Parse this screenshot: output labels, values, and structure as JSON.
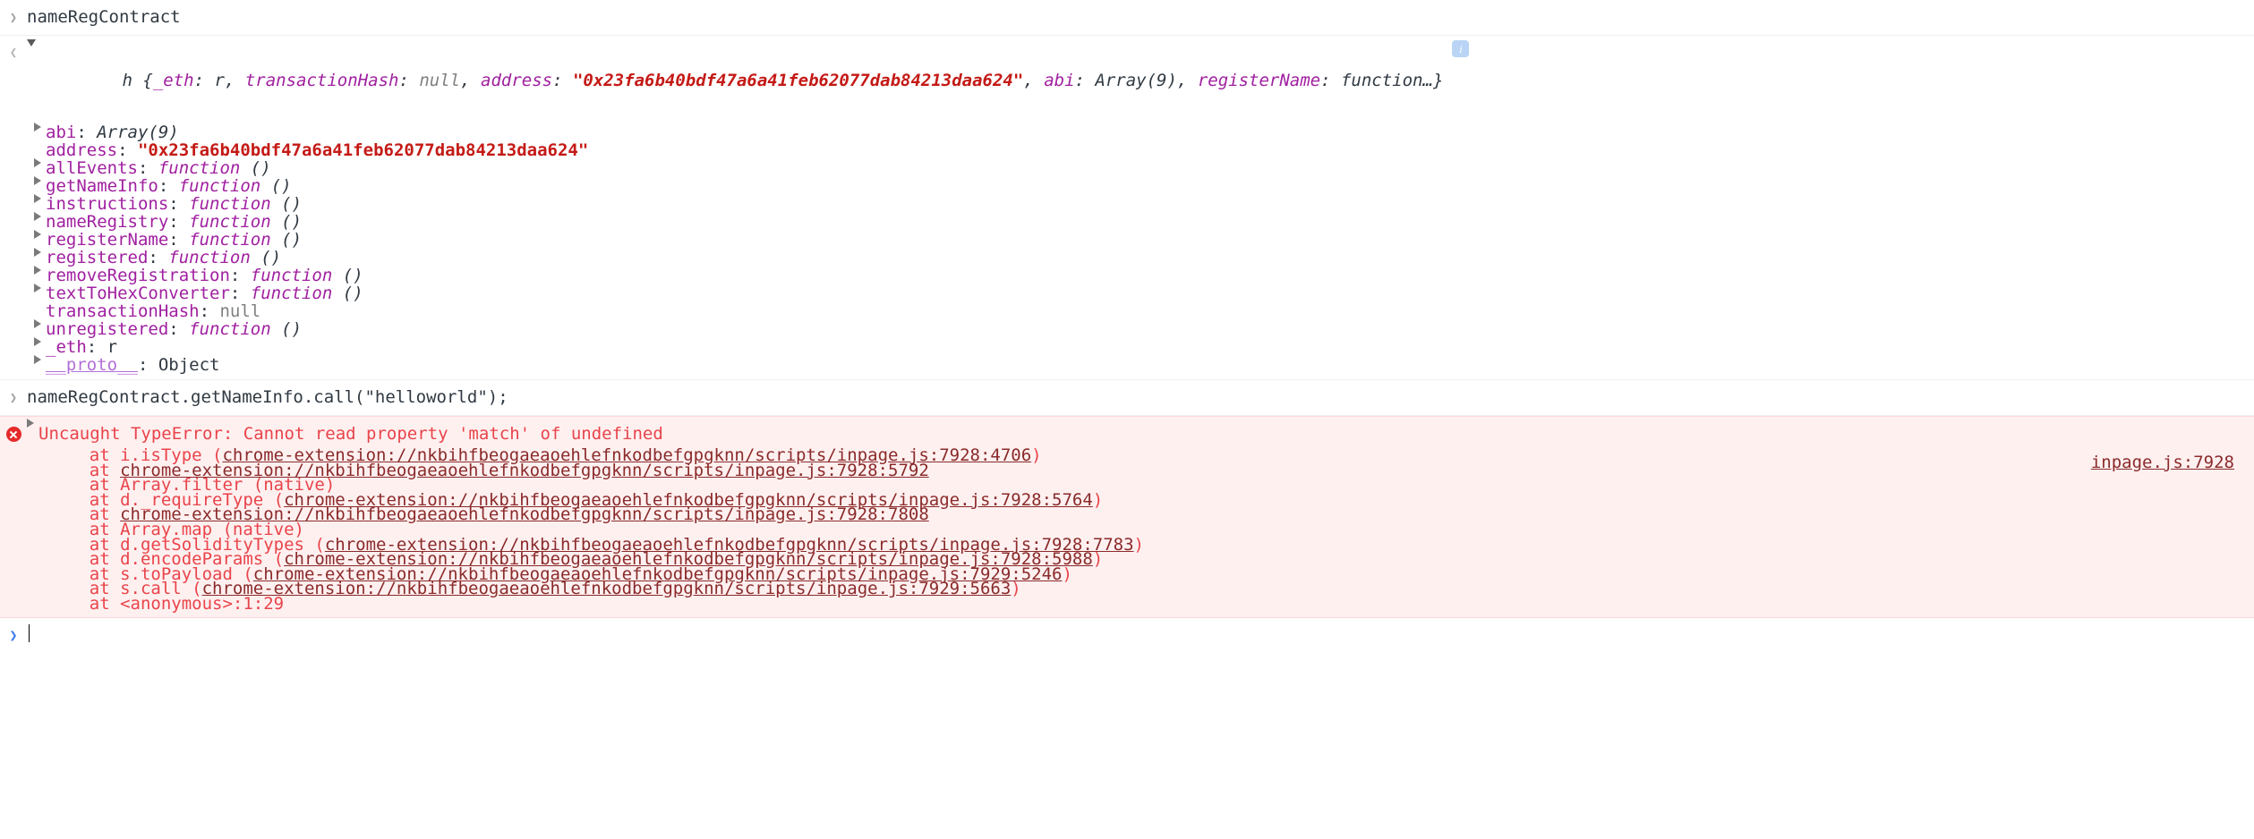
{
  "console": {
    "input_prompt_glyph": "chevron-right",
    "result_prompt_glyph": "chevron-left",
    "commands": [
      {
        "text": "nameRegContract"
      },
      {
        "text": "nameRegContract.getNameInfo.call(\"helloworld\");"
      }
    ],
    "result": {
      "constructor": "h",
      "preview": {
        "open_brace": " {",
        "close": "}",
        "entries": [
          {
            "key": "_eth",
            "sep": ": ",
            "value": "r",
            "value_kind": "class",
            "trail": ", "
          },
          {
            "key": "transactionHash",
            "sep": ": ",
            "value": "null",
            "value_kind": "null",
            "trail": ", "
          },
          {
            "key": "address",
            "sep": ": ",
            "value": "\"0x23fa6b40bdf47a6a41feb62077dab84213daa624\"",
            "value_kind": "string",
            "trail": ", "
          },
          {
            "key": "abi",
            "sep": ": ",
            "value": "Array(9)",
            "value_kind": "class",
            "trail": ", "
          },
          {
            "key": "registerName",
            "sep": ": ",
            "value": "function…",
            "value_kind": "class",
            "trail": ""
          }
        ]
      },
      "info_badge": "i",
      "properties": [
        {
          "expandable": true,
          "name": "abi",
          "sep": ": ",
          "value": "Array(9)",
          "kind": "class"
        },
        {
          "expandable": false,
          "name": "address",
          "sep": ": ",
          "value": "\"0x23fa6b40bdf47a6a41feb62077dab84213daa624\"",
          "kind": "string"
        },
        {
          "expandable": true,
          "name": "allEvents",
          "sep": ": ",
          "value": "function ()",
          "kind": "function"
        },
        {
          "expandable": true,
          "name": "getNameInfo",
          "sep": ": ",
          "value": "function ()",
          "kind": "function"
        },
        {
          "expandable": true,
          "name": "instructions",
          "sep": ": ",
          "value": "function ()",
          "kind": "function"
        },
        {
          "expandable": true,
          "name": "nameRegistry",
          "sep": ": ",
          "value": "function ()",
          "kind": "function"
        },
        {
          "expandable": true,
          "name": "registerName",
          "sep": ": ",
          "value": "function ()",
          "kind": "function"
        },
        {
          "expandable": true,
          "name": "registered",
          "sep": ": ",
          "value": "function ()",
          "kind": "function"
        },
        {
          "expandable": true,
          "name": "removeRegistration",
          "sep": ": ",
          "value": "function ()",
          "kind": "function"
        },
        {
          "expandable": true,
          "name": "textToHexConverter",
          "sep": ": ",
          "value": "function ()",
          "kind": "function"
        },
        {
          "expandable": false,
          "name": "transactionHash",
          "sep": ": ",
          "value": "null",
          "kind": "null"
        },
        {
          "expandable": true,
          "name": "unregistered",
          "sep": ": ",
          "value": "function ()",
          "kind": "function"
        },
        {
          "expandable": true,
          "name": "_eth",
          "sep": ": ",
          "value": "r",
          "kind": "plain"
        },
        {
          "expandable": true,
          "name": "__proto__",
          "sep": ": ",
          "value": "Object",
          "kind": "proto"
        }
      ]
    },
    "error": {
      "icon": "error-circle-icon",
      "message": "Uncaught TypeError: Cannot read property 'match' of undefined",
      "source_link": "inpage.js:7928",
      "stack": [
        {
          "prefix": "    at i.isType (",
          "link": "chrome-extension://nkbihfbeogaeaoehlefnkodbefgpgknn/scripts/inpage.js:7928:4706",
          "suffix": ")"
        },
        {
          "prefix": "    at ",
          "link": "chrome-extension://nkbihfbeogaeaoehlefnkodbefgpgknn/scripts/inpage.js:7928:5792",
          "suffix": ""
        },
        {
          "prefix": "    at Array.filter (native)",
          "link": "",
          "suffix": ""
        },
        {
          "prefix": "    at d._requireType (",
          "link": "chrome-extension://nkbihfbeogaeaoehlefnkodbefgpgknn/scripts/inpage.js:7928:5764",
          "suffix": ")"
        },
        {
          "prefix": "    at ",
          "link": "chrome-extension://nkbihfbeogaeaoehlefnkodbefgpgknn/scripts/inpage.js:7928:7808",
          "suffix": ""
        },
        {
          "prefix": "    at Array.map (native)",
          "link": "",
          "suffix": ""
        },
        {
          "prefix": "    at d.getSolidityTypes (",
          "link": "chrome-extension://nkbihfbeogaeaoehlefnkodbefgpgknn/scripts/inpage.js:7928:7783",
          "suffix": ")"
        },
        {
          "prefix": "    at d.encodeParams (",
          "link": "chrome-extension://nkbihfbeogaeaoehlefnkodbefgpgknn/scripts/inpage.js:7928:5988",
          "suffix": ")"
        },
        {
          "prefix": "    at s.toPayload (",
          "link": "chrome-extension://nkbihfbeogaeaoehlefnkodbefgpgknn/scripts/inpage.js:7929:5246",
          "suffix": ")"
        },
        {
          "prefix": "    at s.call (",
          "link": "chrome-extension://nkbihfbeogaeaoehlefnkodbefgpgknn/scripts/inpage.js:7929:5663",
          "suffix": ")"
        },
        {
          "prefix": "    at <anonymous>:1:29",
          "link": "",
          "suffix": ""
        }
      ]
    },
    "active_prompt": {
      "glyph": "chevron-right",
      "value": ""
    }
  },
  "colors": {
    "property_purple": "#a020a0",
    "string_red": "#c41a16",
    "error_red": "#e8444a",
    "error_bg": "#fff0f0",
    "link_dark_red": "#8a2a2a",
    "proto_purple": "#b36fd8",
    "prompt_blue": "#3b78e7"
  }
}
